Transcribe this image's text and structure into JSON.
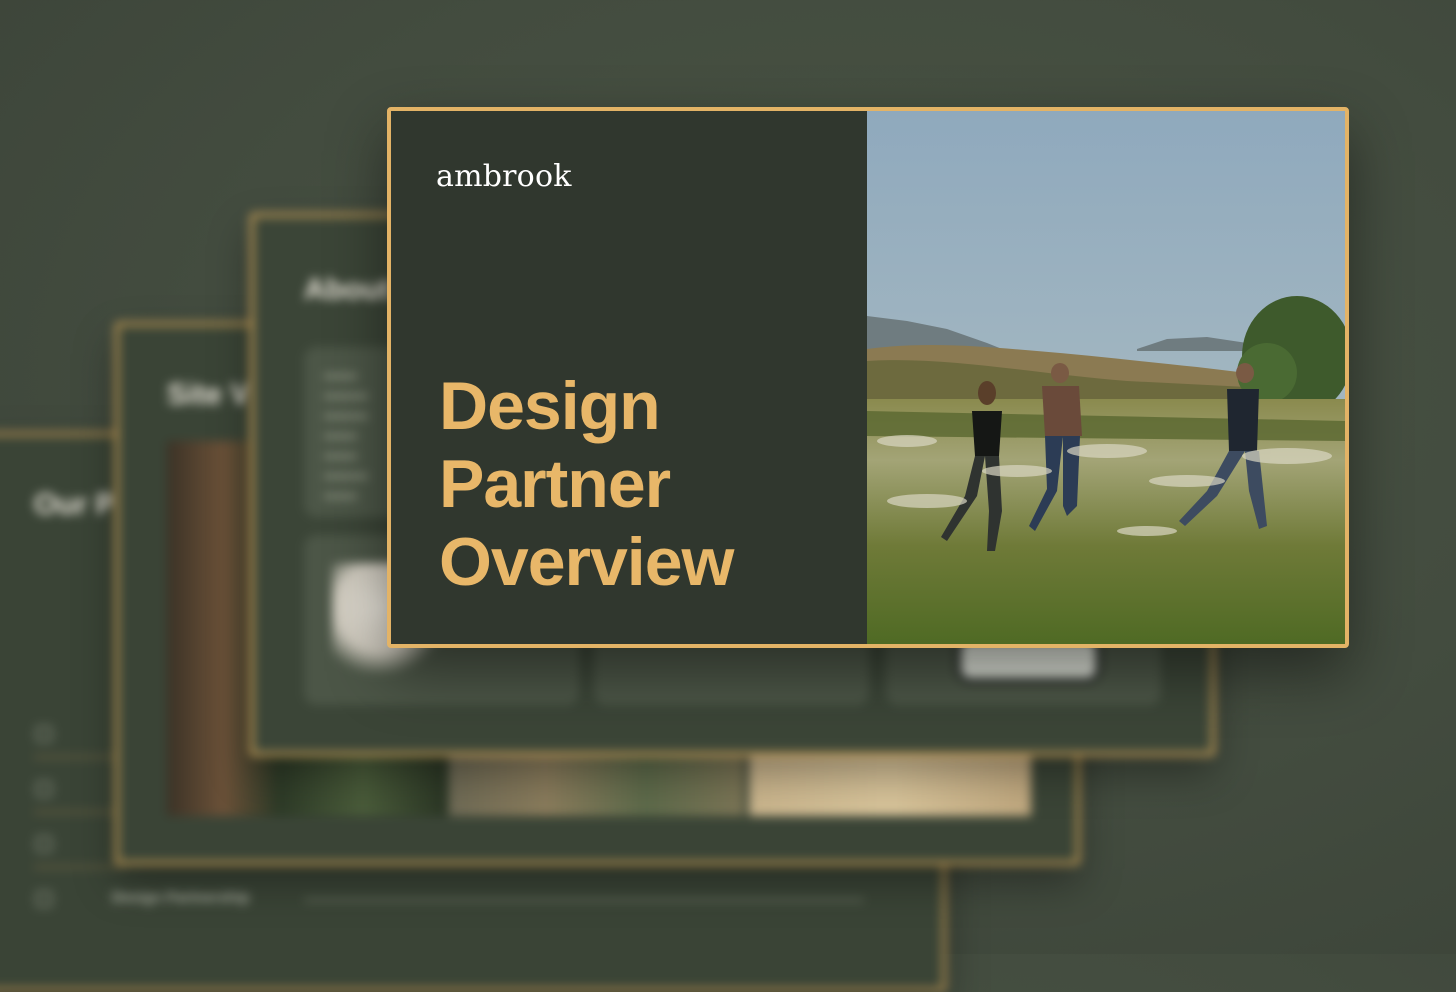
{
  "colors": {
    "background": "#434c3f",
    "slide_fill": "#30372e",
    "accent_border": "#e3b366",
    "headline": "#e8b769",
    "logo": "#ffffff"
  },
  "main_slide": {
    "logo": "ambrook",
    "headline_lines": [
      "Design",
      "Partner",
      "Overview"
    ],
    "photo_icon": "field-photo-people-walking"
  },
  "background_slides": {
    "slide_2": {
      "title": "About"
    },
    "slide_3": {
      "title": "Site V"
    },
    "slide_4": {
      "title": "Our P",
      "last_row_label": "Design Partnership"
    }
  }
}
